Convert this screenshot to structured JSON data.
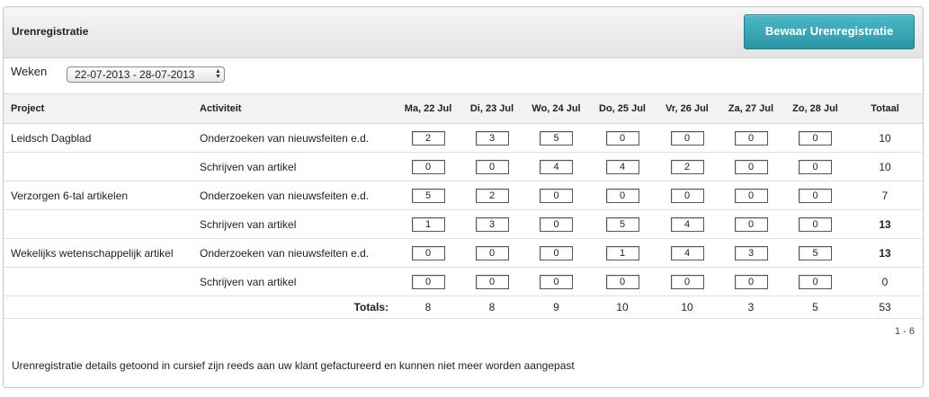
{
  "header": {
    "title": "Urenregistratie",
    "save_label": "Bewaar Urenregistratie"
  },
  "weeks": {
    "label": "Weken",
    "selected": "22-07-2013 - 28-07-2013"
  },
  "table": {
    "columns": [
      "Project",
      "Activiteit",
      "Ma, 22 Jul",
      "Di, 23 Jul",
      "Wo, 24 Jul",
      "Do, 25 Jul",
      "Vr, 26 Jul",
      "Za, 27 Jul",
      "Zo, 28 Jul",
      "Totaal"
    ],
    "rows": [
      {
        "project": "Leidsch Dagblad",
        "activity": "Onderzoeken van nieuwsfeiten e.d.",
        "hours": [
          "2",
          "3",
          "5",
          "0",
          "0",
          "0",
          "0"
        ],
        "total": "10"
      },
      {
        "project": "",
        "activity": "Schrijven van artikel",
        "hours": [
          "0",
          "0",
          "4",
          "4",
          "2",
          "0",
          "0"
        ],
        "total": "10"
      },
      {
        "project": "Verzorgen 6-tal artikelen",
        "activity": "Onderzoeken van nieuwsfeiten e.d.",
        "hours": [
          "5",
          "2",
          "0",
          "0",
          "0",
          "0",
          "0"
        ],
        "total": "7"
      },
      {
        "project": "",
        "activity": "Schrijven van artikel",
        "hours": [
          "1",
          "3",
          "0",
          "5",
          "4",
          "0",
          "0"
        ],
        "total": "13"
      },
      {
        "project": "Wekelijks wetenschappelijk artikel",
        "activity": "Onderzoeken van nieuwsfeiten e.d.",
        "hours": [
          "0",
          "0",
          "0",
          "1",
          "4",
          "3",
          "5"
        ],
        "total": "13"
      },
      {
        "project": "",
        "activity": "Schrijven van artikel",
        "hours": [
          "0",
          "0",
          "0",
          "0",
          "0",
          "0",
          "0"
        ],
        "total": "0"
      }
    ],
    "totals_label": "Totals:",
    "totals": [
      "8",
      "8",
      "9",
      "10",
      "10",
      "3",
      "5",
      "53"
    ]
  },
  "pager": "1 - 6",
  "footer_note": "Urenregistratie details getoond in cursief zijn reeds aan uw klant gefactureerd en kunnen niet meer worden aangepast"
}
